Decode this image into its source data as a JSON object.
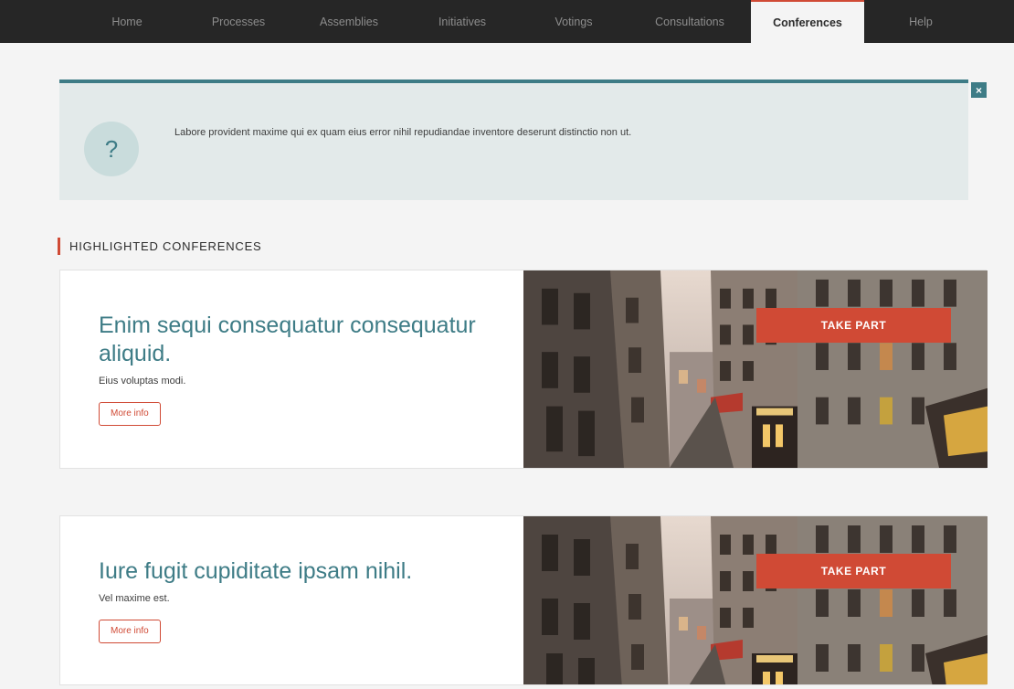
{
  "nav": {
    "items": [
      {
        "label": "Home"
      },
      {
        "label": "Processes"
      },
      {
        "label": "Assemblies"
      },
      {
        "label": "Initiatives"
      },
      {
        "label": "Votings"
      },
      {
        "label": "Consultations"
      },
      {
        "label": "Conferences",
        "active": true
      },
      {
        "label": "Help"
      }
    ]
  },
  "callout": {
    "icon": "question-mark",
    "text": "Labore provident maxime qui ex quam eius error nihil repudiandae inventore deserunt distinctio non ut.",
    "close_label": "×"
  },
  "section": {
    "title": "HIGHLIGHTED CONFERENCES"
  },
  "conferences": [
    {
      "title": "Enim sequi consequatur consequatur aliquid.",
      "subtitle": "Eius voluptas modi.",
      "more_info_label": "More info",
      "take_part_label": "TAKE PART"
    },
    {
      "title": "Iure fugit cupiditate ipsam nihil.",
      "subtitle": "Vel maxime est.",
      "more_info_label": "More info",
      "take_part_label": "TAKE PART"
    }
  ],
  "colors": {
    "nav_bg": "#262626",
    "accent_red": "#d04a35",
    "teal": "#3e7c86",
    "callout_bg": "#e3eaea"
  }
}
